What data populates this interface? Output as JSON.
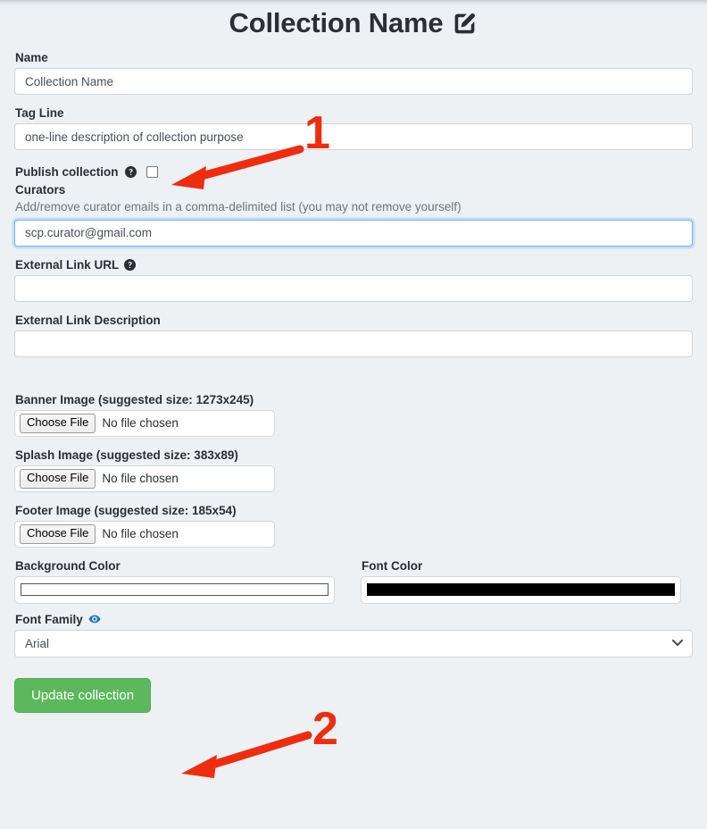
{
  "header": {
    "title": "Collection Name",
    "edit_icon": "pencil-square-icon"
  },
  "form": {
    "name": {
      "label": "Name",
      "value": "Collection Name",
      "placeholder": "Collection Name"
    },
    "tag_line": {
      "label": "Tag Line",
      "value": "one-line description of collection purpose",
      "placeholder": "one-line description of collection purpose"
    },
    "publish_collection": {
      "label": "Publish collection",
      "help_icon": "question-circle-icon",
      "checked": false
    },
    "curators": {
      "label": "Curators",
      "help_text": "Add/remove curator emails in a comma-delimited list (you may not remove yourself)",
      "value": "scp.curator@gmail.com",
      "focused": true
    },
    "external_link_url": {
      "label": "External Link URL",
      "help_icon": "question-circle-icon",
      "value": "",
      "placeholder": ""
    },
    "external_link_description": {
      "label": "External Link Description",
      "value": "",
      "placeholder": ""
    },
    "banner_image": {
      "label": "Banner Image (suggested size: 1273x245)",
      "button_label": "Choose File",
      "status": "No file chosen"
    },
    "splash_image": {
      "label": "Splash Image (suggested size: 383x89)",
      "button_label": "Choose File",
      "status": "No file chosen"
    },
    "footer_image": {
      "label": "Footer Image (suggested size: 185x54)",
      "button_label": "Choose File",
      "status": "No file chosen"
    },
    "background_color": {
      "label": "Background Color",
      "value": "#ffffff"
    },
    "font_color": {
      "label": "Font Color",
      "value": "#000000"
    },
    "font_family": {
      "label": "Font Family",
      "preview_icon": "eye-icon",
      "selected": "Arial",
      "options": [
        "Arial"
      ]
    },
    "submit": {
      "label": "Update collection"
    }
  },
  "annotations": {
    "arrow_color": "#ef2d0e",
    "items": [
      {
        "number": "1",
        "target": "publish-collection-checkbox"
      },
      {
        "number": "2",
        "target": "update-collection-button"
      }
    ]
  },
  "colors": {
    "page_background": "#edf1f4",
    "accent_green": "#5cb85c",
    "focus_blue": "#7bb6ec",
    "annotation_red": "#ef2d0e"
  }
}
